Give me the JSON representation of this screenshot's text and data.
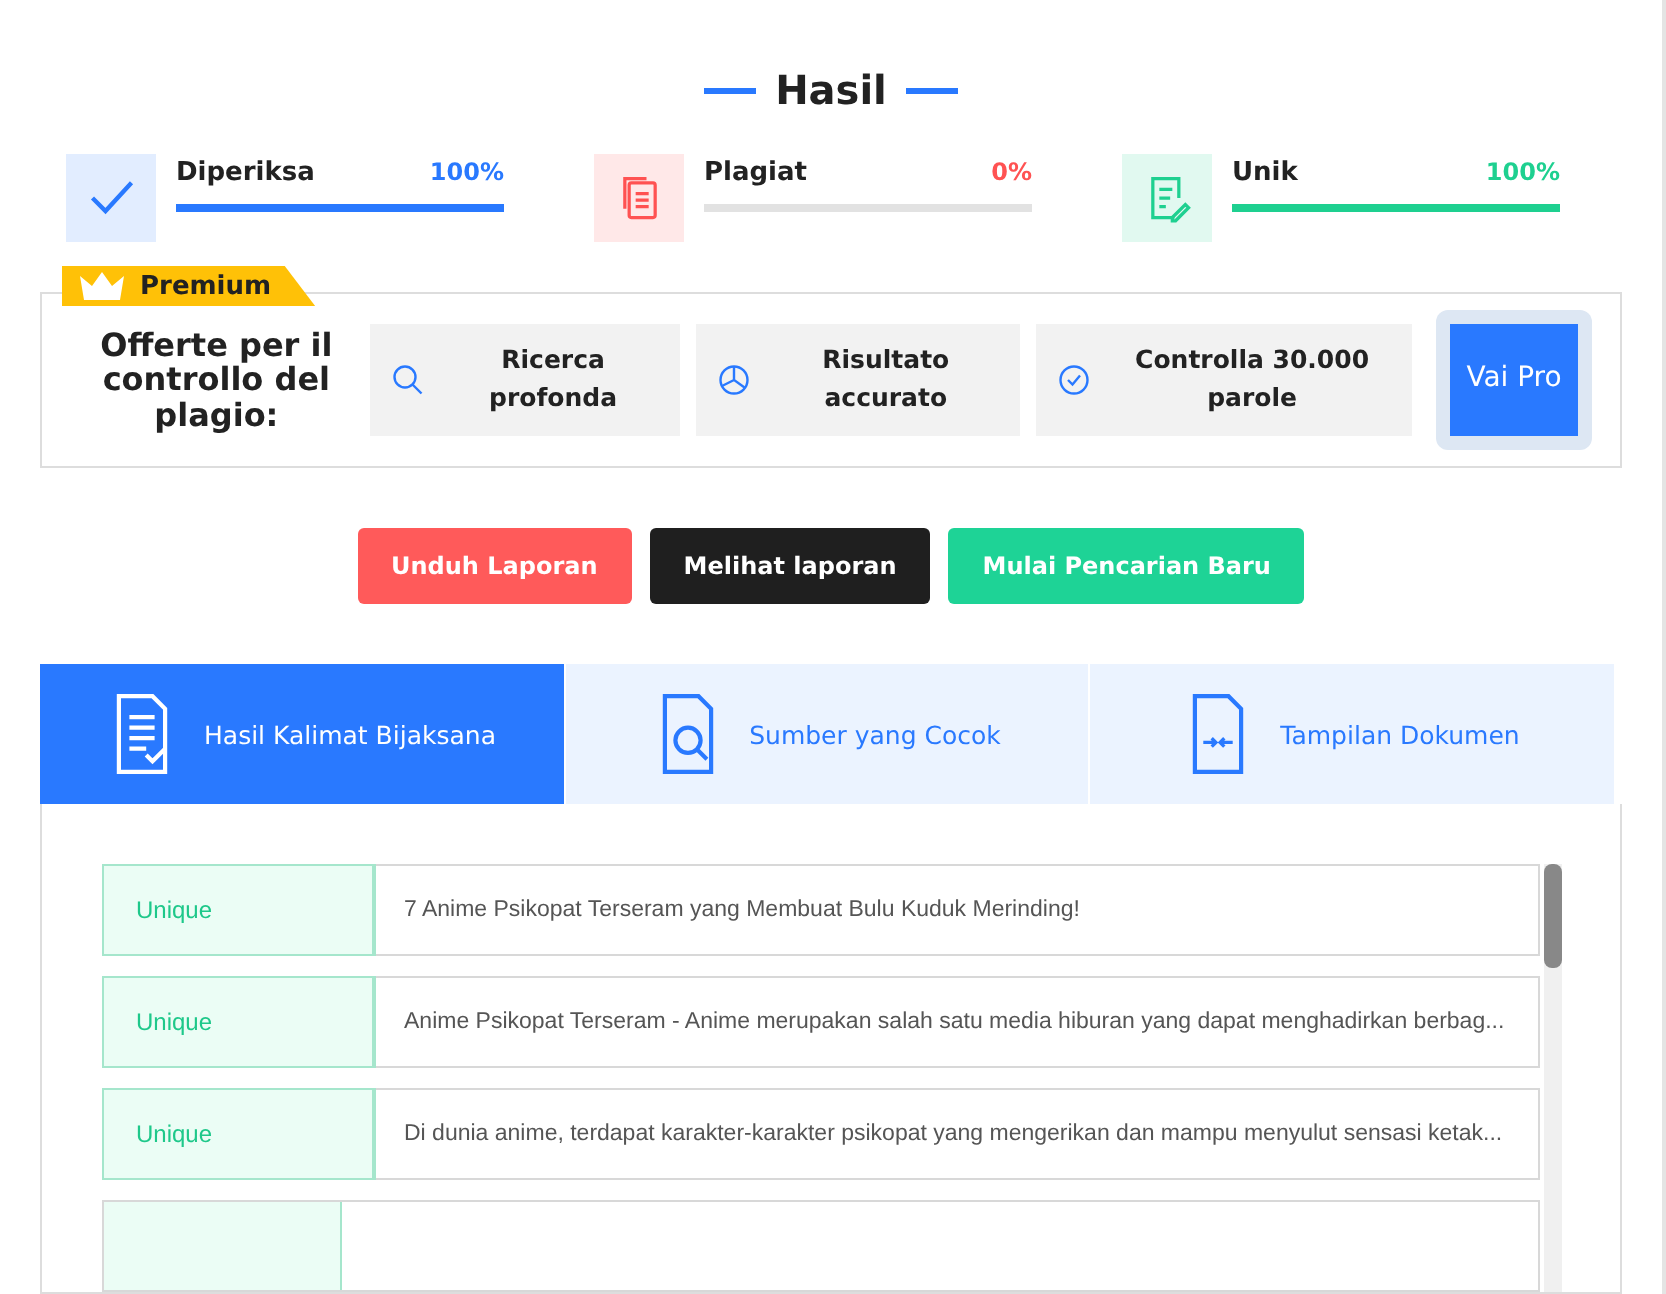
{
  "title": "Hasil",
  "stats": [
    {
      "label": "Diperiksa",
      "value": "100%",
      "level": 1,
      "color": "#2979ff"
    },
    {
      "label": "Plagiat",
      "value": "0%",
      "level": 0,
      "color": "#ff5252"
    },
    {
      "label": "Unik",
      "value": "100%",
      "level": 1,
      "color": "#1ed090"
    }
  ],
  "premium": {
    "badge": "Premium",
    "heading": "Offerte per il controllo del plagio:",
    "offers": [
      {
        "label": "Ricerca profonda"
      },
      {
        "label": "Risultato accurato"
      },
      {
        "label": "Controlla 30.000 parole"
      }
    ],
    "button": "Vai Pro"
  },
  "actions": [
    {
      "label": "Unduh Laporan",
      "color": "#ff5a5a"
    },
    {
      "label": "Melihat laporan",
      "color": "#1f1f1f"
    },
    {
      "label": "Mulai Pencarian Baru",
      "color": "#1ed396"
    }
  ],
  "tabs": [
    {
      "label": "Hasil Kalimat Bijaksana",
      "selected": true
    },
    {
      "label": "Sumber yang Cocok",
      "selected": false
    },
    {
      "label": "Tampilan Dokumen",
      "selected": false
    }
  ],
  "rows": [
    {
      "status": "Unique",
      "text": "7 Anime Psikopat Terseram yang Membuat Bulu Kuduk Merinding!"
    },
    {
      "status": "Unique",
      "text": "Anime Psikopat Terseram - Anime merupakan salah satu media hiburan yang dapat menghadirkan berbag..."
    },
    {
      "status": "Unique",
      "text": "Di dunia anime, terdapat karakter-karakter psikopat yang mengerikan dan mampu menyulut sensasi ketak..."
    }
  ]
}
